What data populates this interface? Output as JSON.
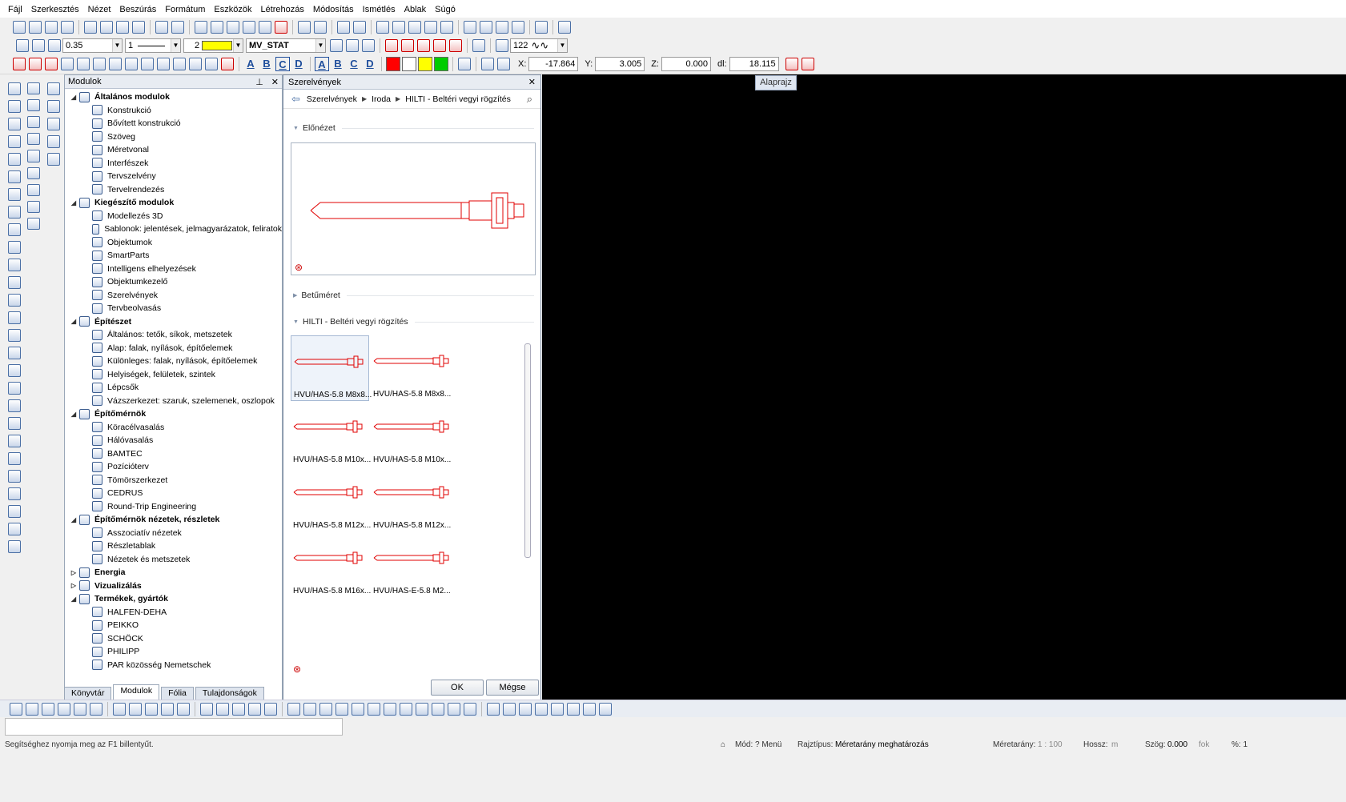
{
  "menu": [
    "Fájl",
    "Szerkesztés",
    "Nézet",
    "Beszúrás",
    "Formátum",
    "Eszközök",
    "Létrehozás",
    "Módosítás",
    "Ismétlés",
    "Ablak",
    "Súgó"
  ],
  "toolbar2": {
    "pen_value": "0.35",
    "line_value": "1",
    "color_value": "2",
    "layer_value": "MV_STAT",
    "count_value": "122"
  },
  "format_letters": [
    "A",
    "B",
    "C",
    "D",
    "A",
    "B",
    "C",
    "D"
  ],
  "swatches": [
    "#ff0000",
    "#ffffff",
    "#ffff00",
    "#00cc00"
  ],
  "coords": {
    "x_label": "X:",
    "x": "-17.864",
    "y_label": "Y:",
    "y": "3.005",
    "z_label": "Z:",
    "z": "0.000",
    "dl_label": "dl:",
    "dl": "18.115"
  },
  "modules_panel": {
    "title": "Modulok",
    "tree": [
      {
        "type": "grp",
        "label": "Általános modulok",
        "open": true
      },
      {
        "type": "item",
        "label": "Konstrukció"
      },
      {
        "type": "item",
        "label": "Bővített konstrukció"
      },
      {
        "type": "item",
        "label": "Szöveg"
      },
      {
        "type": "item",
        "label": "Méretvonal"
      },
      {
        "type": "item",
        "label": "Interfészek"
      },
      {
        "type": "item",
        "label": "Tervszelvény"
      },
      {
        "type": "item",
        "label": "Tervelrendezés"
      },
      {
        "type": "grp",
        "label": "Kiegészítő modulok",
        "open": true
      },
      {
        "type": "item",
        "label": "Modellezés 3D"
      },
      {
        "type": "item",
        "label": "Sablonok: jelentések, jelmagyarázatok, feliratok"
      },
      {
        "type": "item",
        "label": "Objektumok"
      },
      {
        "type": "item",
        "label": "SmartParts"
      },
      {
        "type": "item",
        "label": "Intelligens elhelyezések"
      },
      {
        "type": "item",
        "label": "Objektumkezelő"
      },
      {
        "type": "item",
        "label": "Szerelvények"
      },
      {
        "type": "item",
        "label": "Tervbeolvasás"
      },
      {
        "type": "grp",
        "label": "Építészet",
        "open": true
      },
      {
        "type": "item",
        "label": "Általános: tetők, síkok, metszetek"
      },
      {
        "type": "item",
        "label": "Alap: falak, nyílások, építőelemek"
      },
      {
        "type": "item",
        "label": "Különleges: falak, nyílások, építőelemek"
      },
      {
        "type": "item",
        "label": "Helyiségek, felületek, szintek"
      },
      {
        "type": "item",
        "label": "Lépcsők"
      },
      {
        "type": "item",
        "label": "Vázszerkezet: szaruk, szelemenek, oszlopok"
      },
      {
        "type": "grp",
        "label": "Építőmérnök",
        "open": true
      },
      {
        "type": "item",
        "label": "Köracélvasalás"
      },
      {
        "type": "item",
        "label": "Hálóvasalás"
      },
      {
        "type": "item",
        "label": "BAMTEC"
      },
      {
        "type": "item",
        "label": "Pozícióterv"
      },
      {
        "type": "item",
        "label": "Tömörszerkezet"
      },
      {
        "type": "item",
        "label": "CEDRUS"
      },
      {
        "type": "item",
        "label": "Round-Trip Engineering"
      },
      {
        "type": "grp",
        "label": "Építőmérnök nézetek, részletek",
        "open": true
      },
      {
        "type": "item",
        "label": "Asszociatív nézetek"
      },
      {
        "type": "item",
        "label": "Részletablak"
      },
      {
        "type": "item",
        "label": "Nézetek és metszetek"
      },
      {
        "type": "grp",
        "label": "Energia",
        "open": false
      },
      {
        "type": "grp",
        "label": "Vizualizálás",
        "open": false
      },
      {
        "type": "grp",
        "label": "Termékek, gyártók",
        "open": true
      },
      {
        "type": "item",
        "label": "HALFEN-DEHA"
      },
      {
        "type": "item",
        "label": "PEIKKO"
      },
      {
        "type": "item",
        "label": "SCHÖCK"
      },
      {
        "type": "item",
        "label": "PHILIPP"
      },
      {
        "type": "item",
        "label": "PAR közösség Nemetschek"
      }
    ],
    "tabs": [
      "Könyvtár",
      "Modulok",
      "Fólia",
      "Tulajdonságok"
    ],
    "active_tab": "Modulok"
  },
  "dialog": {
    "title": "Szerelvények",
    "breadcrumb": [
      "Szerelvények",
      "Iroda",
      "HILTI - Beltéri vegyi rögzítés"
    ],
    "preview_section": "Előnézet",
    "font_section": "Betűméret",
    "items_section": "HILTI - Beltéri vegyi rögzítés",
    "items": [
      "HVU/HAS-5.8 M8x8...",
      "HVU/HAS-5.8 M8x8...",
      "HVU/HAS-5.8 M10x...",
      "HVU/HAS-5.8 M10x...",
      "HVU/HAS-5.8 M12x...",
      "HVU/HAS-5.8 M12x...",
      "HVU/HAS-5.8 M16x...",
      "HVU/HAS-E-5.8 M2..."
    ],
    "ok_label": "OK",
    "cancel_label": "Mégse"
  },
  "canvas": {
    "view_label": "Alaprajz"
  },
  "status": {
    "hint": "Segítséghez nyomja meg az F1 billentyűt.",
    "mode": "Mód: ? Menü",
    "draw_type_label": "Rajztípus:",
    "draw_type": "Méretarány meghatározás",
    "scale_label": "Méretarány:",
    "scale": "1 : 100",
    "length_label": "Hossz:",
    "length_unit": "m",
    "angle_label": "Szög:",
    "angle": "0.000",
    "angle_unit": "fok",
    "percent": "%: 1"
  },
  "accent_color": "#e00000"
}
